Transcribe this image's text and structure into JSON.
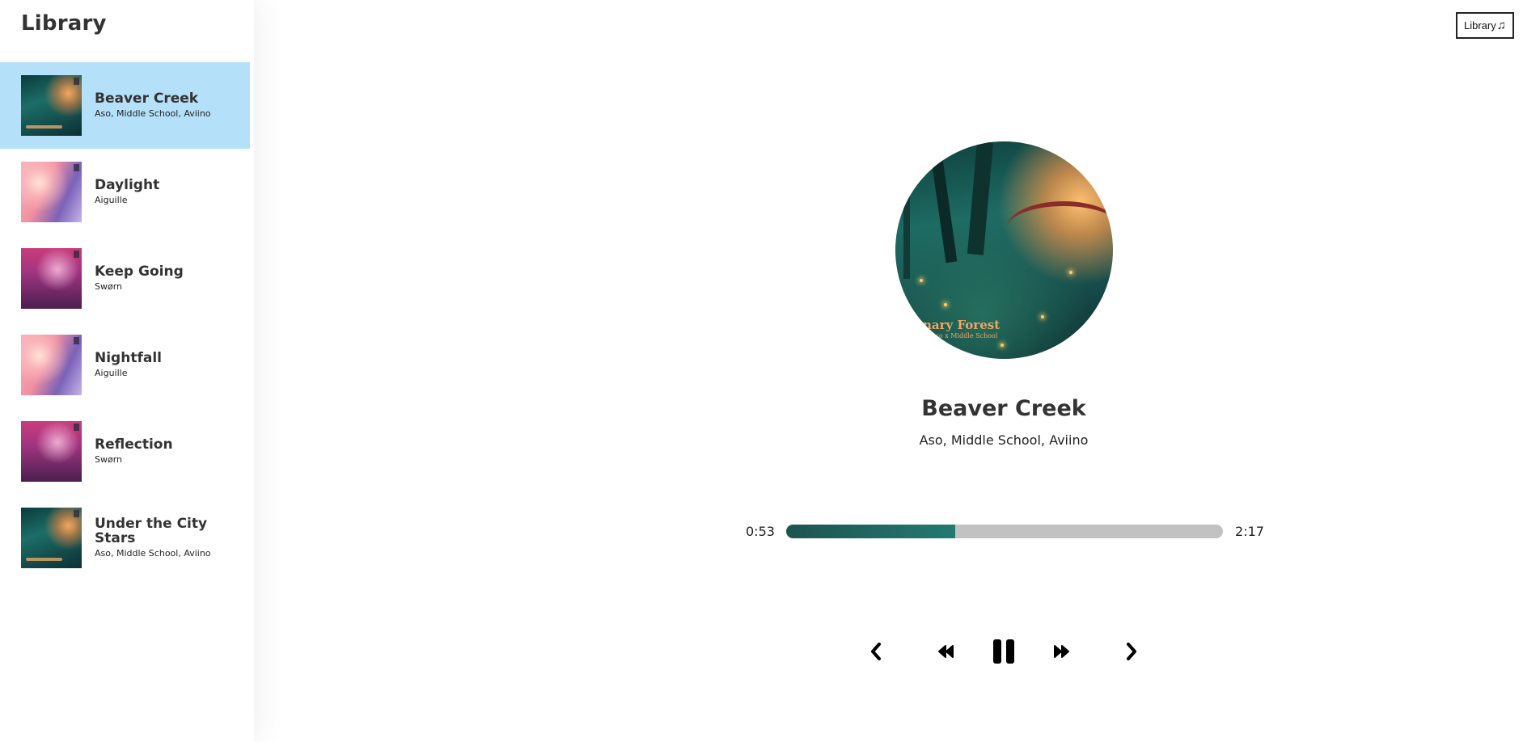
{
  "sidebar": {
    "title": "Library",
    "songs": [
      {
        "title": "Beaver Creek",
        "artist": "Aso, Middle School, Aviino",
        "active": true,
        "art": "forest"
      },
      {
        "title": "Daylight",
        "artist": "Aiguille",
        "active": false,
        "art": "pink"
      },
      {
        "title": "Keep Going",
        "artist": "Swørn",
        "active": false,
        "art": "magenta"
      },
      {
        "title": "Nightfall",
        "artist": "Aiguille",
        "active": false,
        "art": "pink"
      },
      {
        "title": "Reflection",
        "artist": "Swørn",
        "active": false,
        "art": "magenta"
      },
      {
        "title": "Under the City Stars",
        "artist": "Aso, Middle School, Aviino",
        "active": false,
        "art": "forest"
      }
    ]
  },
  "header": {
    "library_button_label": "Library",
    "library_button_icon": "music-note-icon"
  },
  "player": {
    "cover_lettering": "nary Forest",
    "cover_lettering_sub": "Aso x Middle School",
    "title": "Beaver Creek",
    "artist": "Aso, Middle School, Aviino",
    "current_time": "0:53",
    "total_time": "2:17",
    "progress_fraction": 0.387,
    "controls": [
      "previous-song-icon",
      "skip-back-icon",
      "pause-icon",
      "skip-forward-icon",
      "next-song-icon"
    ]
  },
  "colors": {
    "active_item_bg": "#b4e0fa",
    "progress_fill": "#237a71",
    "progress_track": "#c2c2c2"
  }
}
